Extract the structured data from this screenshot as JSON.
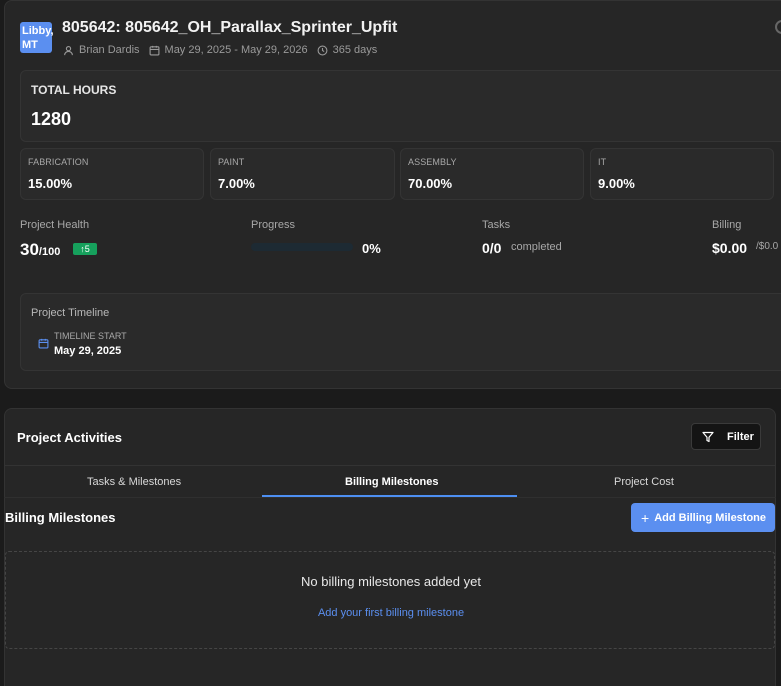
{
  "project": {
    "logo_text": "Libby, MT",
    "title": "805642: 805642_OH_Parallax_Sprinter_Upfit",
    "owner": "Brian Dardis",
    "date_range": "May 29, 2025 - May 29, 2026",
    "duration": "365 days"
  },
  "hours": {
    "label": "TOTAL HOURS",
    "value": "1280"
  },
  "departments": [
    {
      "label": "FABRICATION",
      "value": "15.00%"
    },
    {
      "label": "PAINT",
      "value": "7.00%"
    },
    {
      "label": "ASSEMBLY",
      "value": "70.00%"
    },
    {
      "label": "IT",
      "value": "9.00%"
    }
  ],
  "stats": {
    "health_label": "Project Health",
    "health_value": "30",
    "health_max": "/100",
    "health_delta": "5",
    "progress_label": "Progress",
    "progress_value": "0%",
    "progress_fraction": 0,
    "tasks_label": "Tasks",
    "tasks_value": "0/0",
    "tasks_suffix": "completed",
    "billing_label": "Billing",
    "billing_value": "$0.00",
    "billing_suffix": "/$0.0"
  },
  "timeline": {
    "title": "Project Timeline",
    "start_label": "TIMELINE START",
    "start_date": "May 29, 2025"
  },
  "activities": {
    "title": "Project Activities",
    "filter_label": "Filter",
    "tabs": [
      "Tasks & Milestones",
      "Billing Milestones",
      "Project Cost"
    ],
    "active_tab": "Billing Milestones"
  },
  "billing_milestones": {
    "title": "Billing Milestones",
    "add_label": "Add Billing Milestone",
    "empty_text": "No billing milestones added yet",
    "empty_link": "Add your first billing milestone"
  },
  "colors": {
    "accent": "#5b8ff0",
    "success": "#16a05c",
    "background": "#1b1b1b",
    "card": "#262626"
  }
}
